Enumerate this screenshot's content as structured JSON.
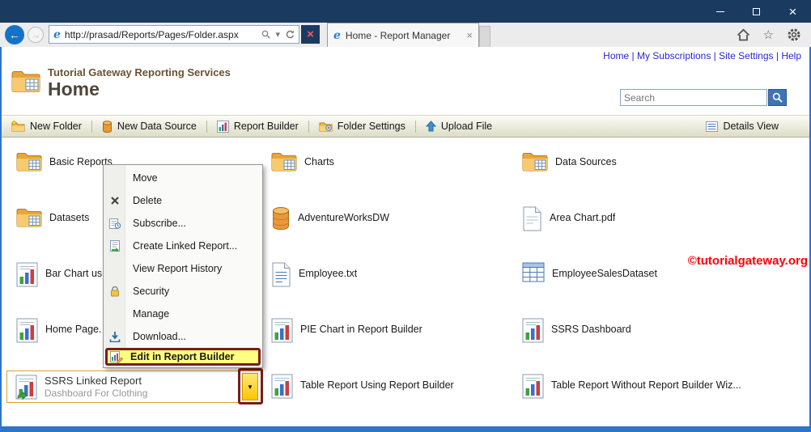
{
  "browser": {
    "url": "http://prasad/Reports/Pages/Folder.aspx",
    "tab_title": "Home - Report Manager"
  },
  "header": {
    "nav_links": [
      "Home",
      "My Subscriptions",
      "Site Settings",
      "Help"
    ],
    "site_title": "Tutorial Gateway Reporting Services",
    "page_title": "Home",
    "search_placeholder": "Search"
  },
  "toolbar": {
    "items": [
      "New Folder",
      "New Data Source",
      "Report Builder",
      "Folder Settings",
      "Upload File"
    ],
    "details_view": "Details View"
  },
  "grid": {
    "items": [
      {
        "label": "Basic Reports",
        "type": "folder"
      },
      {
        "label": "Charts",
        "type": "folder"
      },
      {
        "label": "Data Sources",
        "type": "folder"
      },
      {
        "label": "Datasets",
        "type": "folder"
      },
      {
        "label": "AdventureWorksDW",
        "type": "database"
      },
      {
        "label": "Area Chart.pdf",
        "type": "file"
      },
      {
        "label": "Bar Chart us",
        "type": "report"
      },
      {
        "label": "Employee.txt",
        "type": "textfile"
      },
      {
        "label": "EmployeeSalesDataset",
        "type": "dataset"
      },
      {
        "label": "Home Page.",
        "type": "report"
      },
      {
        "label": "PIE Chart in Report Builder",
        "type": "report"
      },
      {
        "label": "SSRS Dashboard",
        "type": "report"
      },
      {
        "label": "SSRS Linked Report",
        "subtitle": "Dashboard For Clothing",
        "type": "linked-report",
        "selected": true
      },
      {
        "label": "Table Report Using Report Builder",
        "type": "report"
      },
      {
        "label": "Table Report Without Report Builder Wiz...",
        "type": "report"
      }
    ]
  },
  "context_menu": {
    "items": [
      {
        "label": "Move"
      },
      {
        "label": "Delete",
        "icon": "delete-icon"
      },
      {
        "label": "Subscribe...",
        "icon": "subscribe-icon"
      },
      {
        "label": "Create Linked Report...",
        "icon": "linked-report-icon"
      },
      {
        "label": "View Report History"
      },
      {
        "label": "Security",
        "icon": "lock-icon"
      },
      {
        "label": "Manage"
      },
      {
        "label": "Download...",
        "icon": "download-icon"
      },
      {
        "label": "Edit in Report Builder",
        "icon": "report-builder-icon",
        "highlighted": true
      }
    ]
  },
  "watermark": "©tutorialgateway.org",
  "icons": {
    "back": "←",
    "forward": "→",
    "close": "×",
    "stop": "×",
    "caret_down": "▾",
    "dropdown_caret": "▼",
    "star": "☆",
    "ie": "e"
  },
  "colors": {
    "titlebar": "#1b3a5f",
    "frame_blue": "#2e74c9",
    "link_blue": "#2727d4",
    "highlight_yellow": "#feff80",
    "annotation_maroon": "#7b1c1c",
    "watermark_red": "#ff0000",
    "toolbar_tan": "#ddddc8",
    "selection_orange": "#e0a132"
  }
}
